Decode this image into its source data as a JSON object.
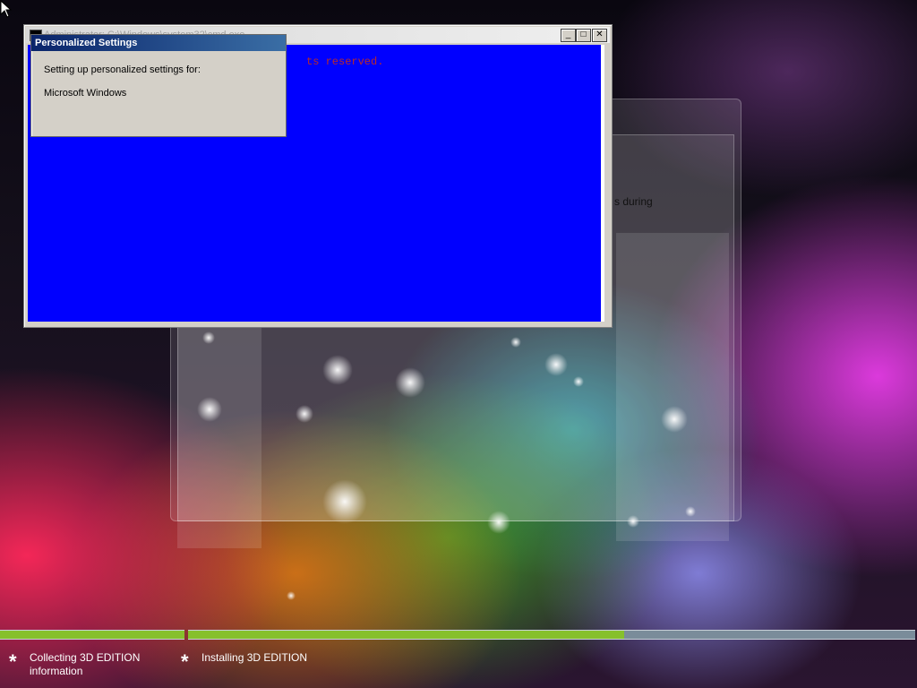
{
  "console_window": {
    "title": "Administrator: C:\\Windows\\system32\\cmd.exe",
    "body_text": "ts reserved.",
    "minimize_symbol": "_",
    "maximize_symbol": "□",
    "close_symbol": "✕",
    "background_color": "#0000ff"
  },
  "dialog": {
    "title": "Personalized Settings",
    "line1": "Setting up personalized settings for:",
    "line2": "Microsoft Windows"
  },
  "background_setup": {
    "partial_text": "s during"
  },
  "progress": {
    "steps": [
      {
        "label": "Collecting 3D EDITION information",
        "fill": 1.0
      },
      {
        "label": "Installing 3D EDITION",
        "fill": 0.6
      }
    ],
    "step_marker": "*",
    "fill_color": "#86c02c"
  },
  "cursor": {
    "icon": "arrow-pointer-icon"
  }
}
